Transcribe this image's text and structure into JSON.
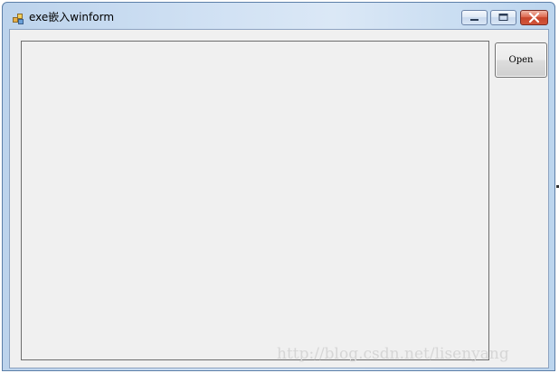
{
  "window": {
    "title": "exe嵌入winform",
    "icons": {
      "app": "app-icon",
      "minimize": "minimize-icon",
      "maximize": "maximize-icon",
      "close": "close-icon"
    }
  },
  "main": {
    "open_button_label": "Open"
  },
  "watermark": {
    "text": "http://blog.csdn.net/lisenyang"
  },
  "colors": {
    "titlebar": "#cfe0f3",
    "client_background": "#f0f0f0",
    "close_button": "#c7452c",
    "panel_border": "#6d6d6d"
  }
}
